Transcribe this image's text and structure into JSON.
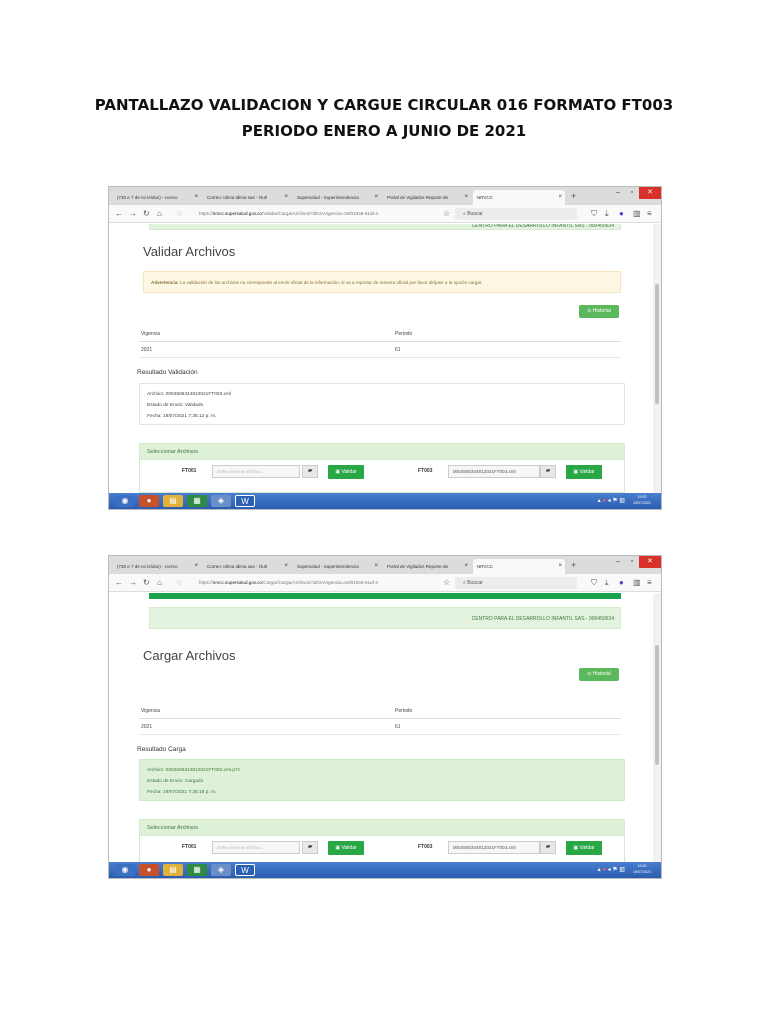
{
  "document": {
    "title_line1": "PANTALLAZO VALIDACION Y CARGUE CIRCULAR 016 FORMATO FT003",
    "title_line2": "PERIODO ENERO A JUNIO DE 2021"
  },
  "browser": {
    "tabs": [
      "(730 e 7 de no leídos) - correo",
      "Correo: Idima Idima sas - Outl",
      "Supersalud - Superintendencia",
      "Portal de Vigilados Reporte de",
      "NRVCC"
    ],
    "tab_close_glyph": "×",
    "new_tab_glyph": "+",
    "search_placeholder": "Buscar",
    "screen1_url_host": "nrvcc.supersalud.gov.co",
    "screen1_url_path": "/Validar/CargarArchivos?idGrnVigencia=2ef01948-61af-4",
    "screen2_url_host": "nrvcc.supersalud.gov.co",
    "screen2_url_path": "/Cargar/CargarArchivos?idGrnVigencia=2ef01948-61af-4",
    "url_prefix": "https://"
  },
  "common": {
    "entity": "CENTRO PARA EL DESARROLLO INFANTIL SAS - 900450634",
    "historial_button": "Historial",
    "col_vigencia": "Vigencia",
    "col_periodo": "Periodo",
    "vigencia_value": "2021",
    "periodo_value": "61",
    "select_header": "Seleccionar Archivos",
    "ft001_label": "FT001",
    "ft001_placeholder": "Seleccione el archivo...",
    "ft003_label": "FT003",
    "ft003_file": "0004506344812021FT003.xml",
    "validar_button": "Validar"
  },
  "screen1": {
    "heading": "Validar Archivos",
    "warning_strong": "Advertencia:",
    "warning_text": "La validación de los archivos no corresponde al envío oficial de la información, si va a reportar de manera oficial por favor diríjase a la opción cargar.",
    "result_title": "Resultado Validación",
    "result_file": "Archivo: 0004506344812021FT003.xml",
    "result_state": "Estado de Envío: Validado",
    "result_date": "Fecha: 19/07/2021 7:35:12 p. m."
  },
  "screen2": {
    "heading": "Cargar Archivos",
    "result_title": "Resultado Carga",
    "result_file": "Archivo: 0004506344812021FT003.xml.p7z",
    "result_state": "Estado de Envío: Cargado",
    "result_date": "Fecha: 19/07/2021 7:38:18 p. m."
  },
  "taskbar": {
    "clock_time": "19:20",
    "clock_date": "19/07/2021"
  },
  "colors": {
    "success_green": "#28a745",
    "warning_bg": "#fcf8e3",
    "taskbar_blue": "#2a5cb0"
  }
}
